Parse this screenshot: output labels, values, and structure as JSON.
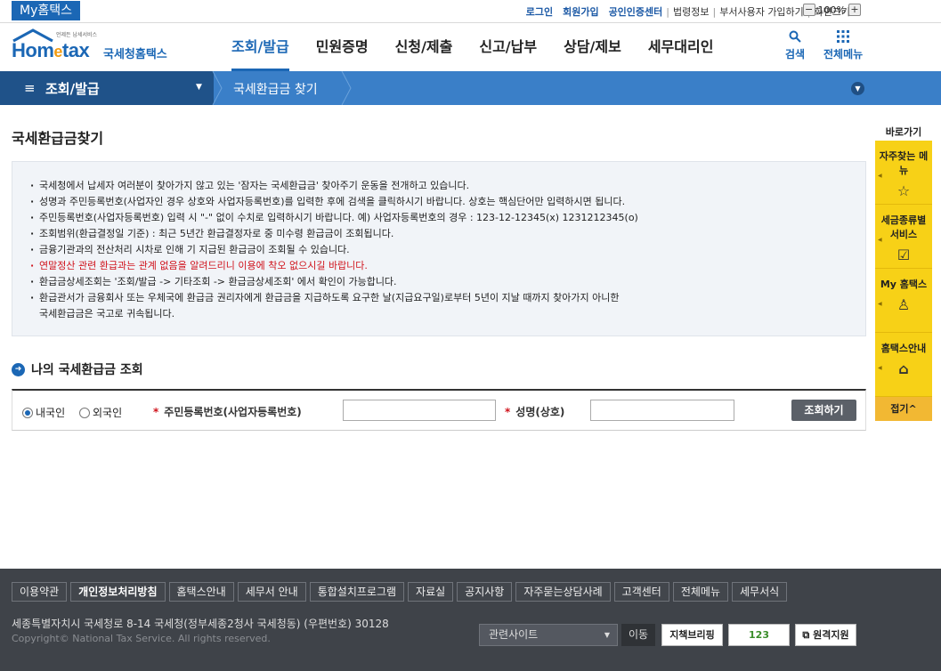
{
  "topbar": {
    "my_tab": "My홈택스",
    "links": [
      {
        "label": "로그인",
        "strong": true
      },
      {
        "label": "회원가입",
        "strong": true
      },
      {
        "label": "공인인증센터",
        "strong": true
      },
      {
        "label": "법령정보",
        "strong": false
      },
      {
        "label": "부서사용자 가입하기",
        "strong": false
      },
      {
        "label": "화면크기",
        "strong": false
      }
    ],
    "zoom_minus": "−",
    "zoom_value": "100%",
    "zoom_plus": "+"
  },
  "logo": {
    "tagline": "언제든 납세서비스",
    "brand_a": "Hom",
    "brand_e": "e",
    "brand_b": "tax",
    "korean": "국세청홈택스"
  },
  "gnb": {
    "items": [
      "조회/발급",
      "민원증명",
      "신청/제출",
      "신고/납부",
      "상담/제보",
      "세무대리인"
    ],
    "active_index": 0,
    "search_label": "검색",
    "allmenu_label": "전체메뉴"
  },
  "navbar": {
    "section": "조회/발급",
    "crumb": "국세환급금 찾기"
  },
  "page": {
    "title": "국세환급금찾기",
    "notices": [
      {
        "text": "국세청에서 납세자 여러분이 찾아가지 않고 있는 '잠자는 국세환급금' 찾아주기 운동을 전개하고 있습니다.",
        "red": false
      },
      {
        "text": "성명과 주민등록번호(사업자인 경우 상호와 사업자등록번호)를 입력한 후에 검색을 클릭하시기 바랍니다. 상호는 핵심단어만 입력하시면 됩니다.",
        "red": false
      },
      {
        "text": "주민등록번호(사업자등록번호) 입력 시 \"-\" 없이 수치로 입력하시기 바랍니다. 예) 사업자등록번호의 경우 : 123-12-12345(x) 1231212345(o)",
        "red": false
      },
      {
        "text": "조회범위(환급결정일 기준) : 최근 5년간 환급결정자로 중 미수령 환급금이 조회됩니다.",
        "red": false
      },
      {
        "text": "금융기관과의 전산처리 시차로 인해 기 지급된 환급금이 조회될 수 있습니다.",
        "red": false
      },
      {
        "text": "연말정산 관련 환급과는 관계 없음을 알려드리니 이용에 착오 없으시길 바랍니다.",
        "red": true
      },
      {
        "text": "환급금상세조회는 '조회/발급 -> 기타조회 -> 환급금상세조회' 에서 확인이 가능합니다.",
        "red": false
      },
      {
        "text": "환급관서가 금융회사 또는 우체국에 환급금 권리자에게 환급금을 지급하도록 요구한 날(지급요구일)로부터 5년이 지날 때까지 찾아가지 아니한",
        "cont": "국세환급금은 국고로 귀속됩니다.",
        "red": false
      }
    ],
    "section_title": "나의 국세환급금 조회",
    "search": {
      "radio_domestic": "내국인",
      "radio_foreign": "외국인",
      "required_mark": "*",
      "id_label": "주민등록번호(사업자등록번호)",
      "name_label": "성명(상호)",
      "id_value": "",
      "name_value": "",
      "query_button": "조회하기"
    }
  },
  "quick": {
    "head": "바로가기",
    "items": [
      {
        "label": "자주찾는 메뉴",
        "icon": "star-icon",
        "glyph": "☆"
      },
      {
        "label": "세금종류별 서비스",
        "icon": "check-box-icon",
        "glyph": "☑"
      },
      {
        "label": "My 홈택스",
        "icon": "user-icon",
        "glyph": "♙"
      },
      {
        "label": "홈택스안내",
        "icon": "house-icon",
        "glyph": "⌂"
      }
    ],
    "close": "접기^"
  },
  "footer": {
    "links": [
      {
        "label": "이용약관",
        "hl": false
      },
      {
        "label": "개인정보처리방침",
        "hl": true
      },
      {
        "label": "홈택스안내",
        "hl": false
      },
      {
        "label": "세무서 안내",
        "hl": false
      },
      {
        "label": "통합설치프로그램",
        "hl": false
      },
      {
        "label": "자료실",
        "hl": false
      },
      {
        "label": "공지사항",
        "hl": false
      },
      {
        "label": "자주묻는상담사례",
        "hl": false
      },
      {
        "label": "고객센터",
        "hl": false
      },
      {
        "label": "전체메뉴",
        "hl": false
      },
      {
        "label": "세무서식",
        "hl": false
      }
    ],
    "address": "세종특별자치시 국세청로 8-14 국세청(정부세종2청사 국세청동) (우편번호) 30128",
    "copyright": "Copyright© National Tax Service. All rights reserved.",
    "related_site": "관련사이트",
    "move": "이동",
    "badge_policy": "지책브리핑",
    "badge_123": "123",
    "badge_remote": "원격지원"
  }
}
